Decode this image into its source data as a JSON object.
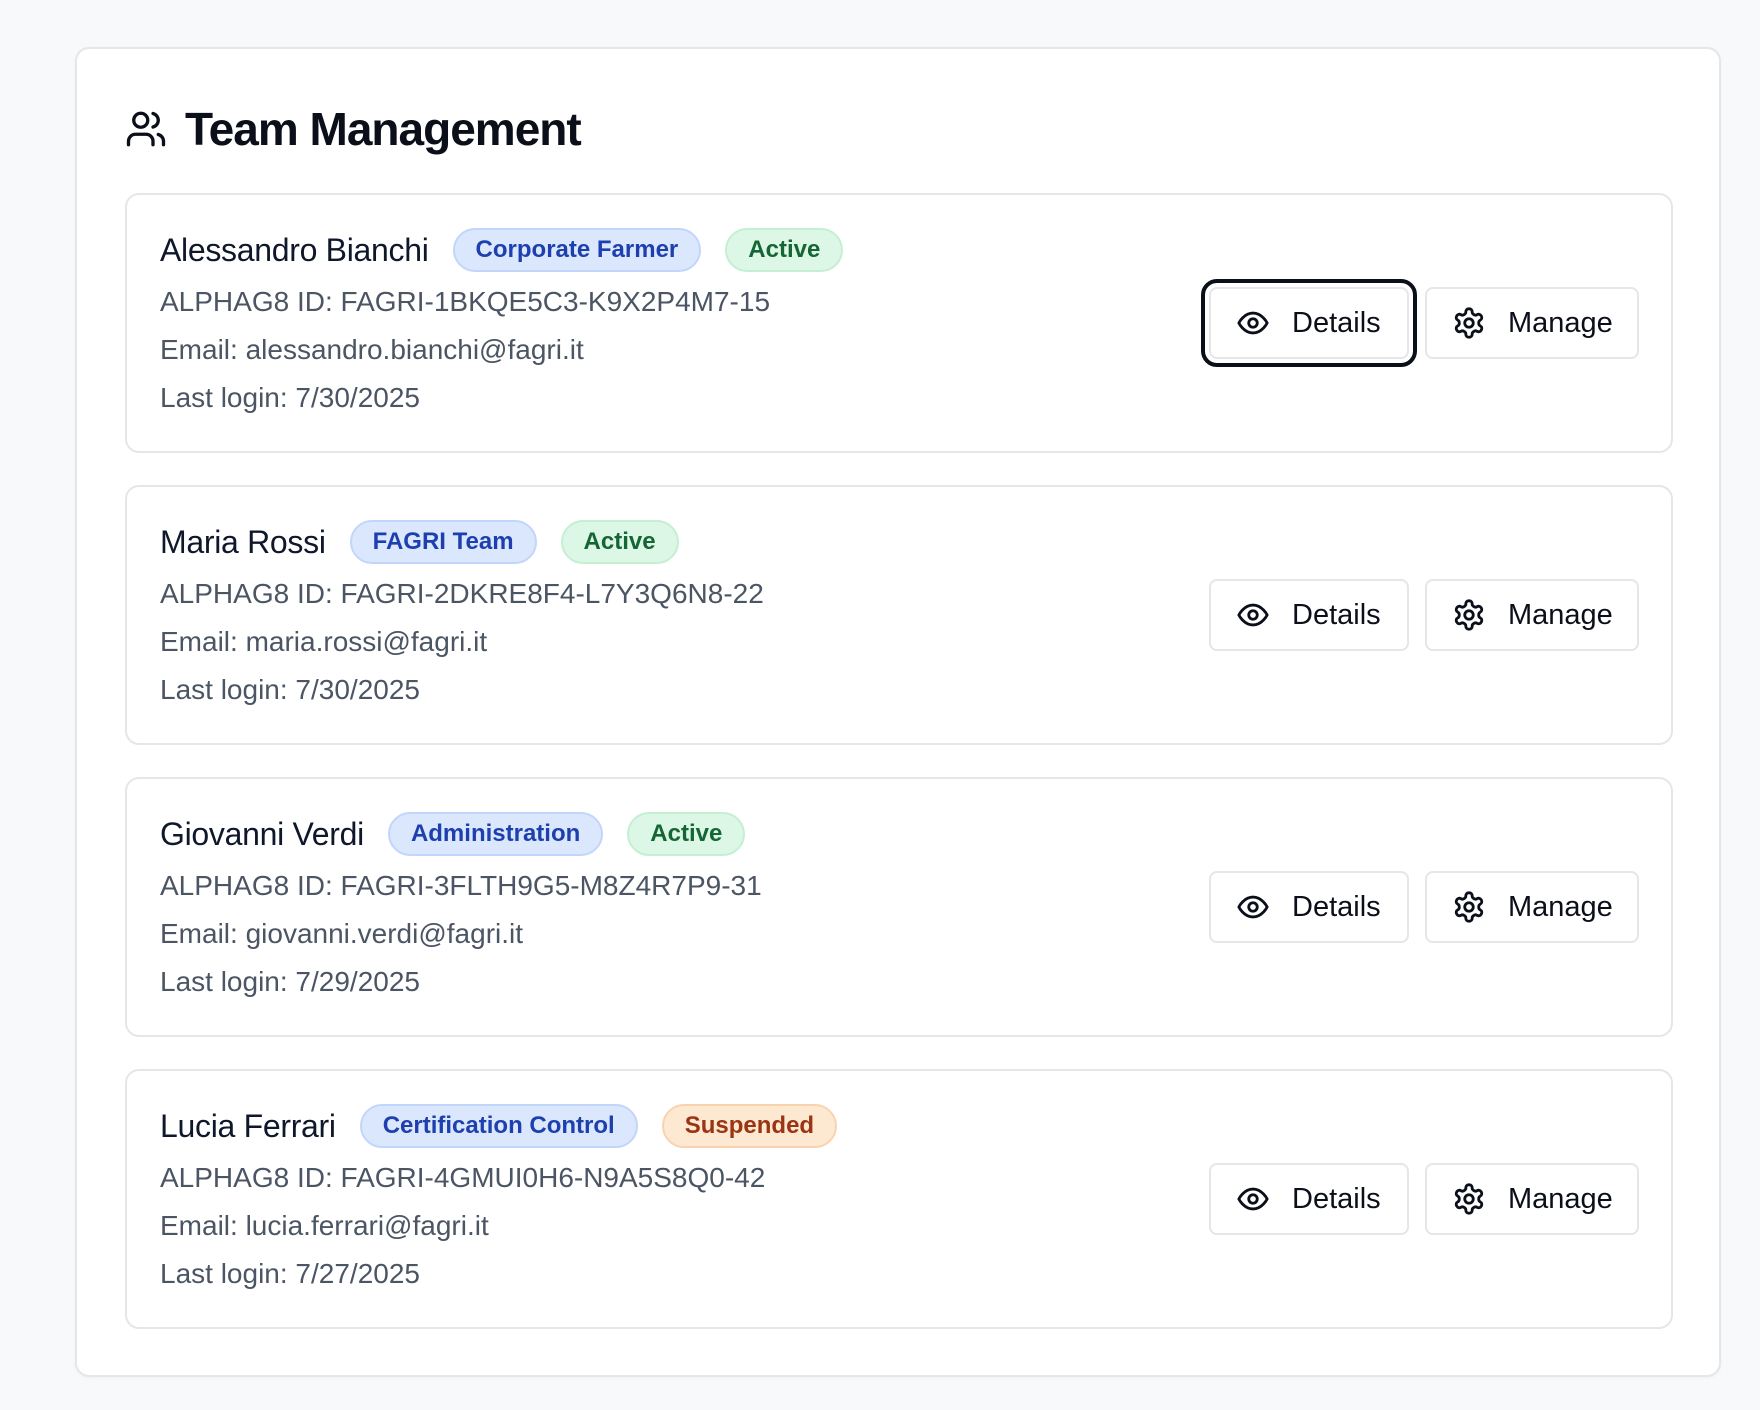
{
  "header": {
    "title": "Team Management",
    "icon": "users-icon"
  },
  "members": [
    {
      "name": "Alessandro Bianchi",
      "role": "Corporate Farmer",
      "status": "Active",
      "status_type": "active",
      "id_line": "ALPHAG8 ID: FAGRI-1BKQE5C3-K9X2P4M7-15",
      "email_line": "Email: alessandro.bianchi@fagri.it",
      "last_login_line": "Last login: 7/30/2025",
      "details_label": "Details",
      "manage_label": "Manage"
    },
    {
      "name": "Maria Rossi",
      "role": "FAGRI Team",
      "status": "Active",
      "status_type": "active",
      "id_line": "ALPHAG8 ID: FAGRI-2DKRE8F4-L7Y3Q6N8-22",
      "email_line": "Email: maria.rossi@fagri.it",
      "last_login_line": "Last login: 7/30/2025",
      "details_label": "Details",
      "manage_label": "Manage"
    },
    {
      "name": "Giovanni Verdi",
      "role": "Administration",
      "status": "Active",
      "status_type": "active",
      "id_line": "ALPHAG8 ID: FAGRI-3FLTH9G5-M8Z4R7P9-31",
      "email_line": "Email: giovanni.verdi@fagri.it",
      "last_login_line": "Last login: 7/29/2025",
      "details_label": "Details",
      "manage_label": "Manage"
    },
    {
      "name": "Lucia Ferrari",
      "role": "Certification Control",
      "status": "Suspended",
      "status_type": "suspended",
      "id_line": "ALPHAG8 ID: FAGRI-4GMUI0H6-N9A5S8Q0-42",
      "email_line": "Email: lucia.ferrari@fagri.it",
      "last_login_line": "Last login: 7/27/2025",
      "details_label": "Details",
      "manage_label": "Manage"
    }
  ],
  "icons": {
    "details": "eye-icon",
    "manage": "gear-icon"
  },
  "colors": {
    "role_badge_bg": "#dbe7fd",
    "role_badge_text": "#1e40af",
    "active_badge_bg": "#dcf7e5",
    "active_badge_text": "#166534",
    "suspended_badge_bg": "#fde8d2",
    "suspended_badge_text": "#9a3412"
  }
}
